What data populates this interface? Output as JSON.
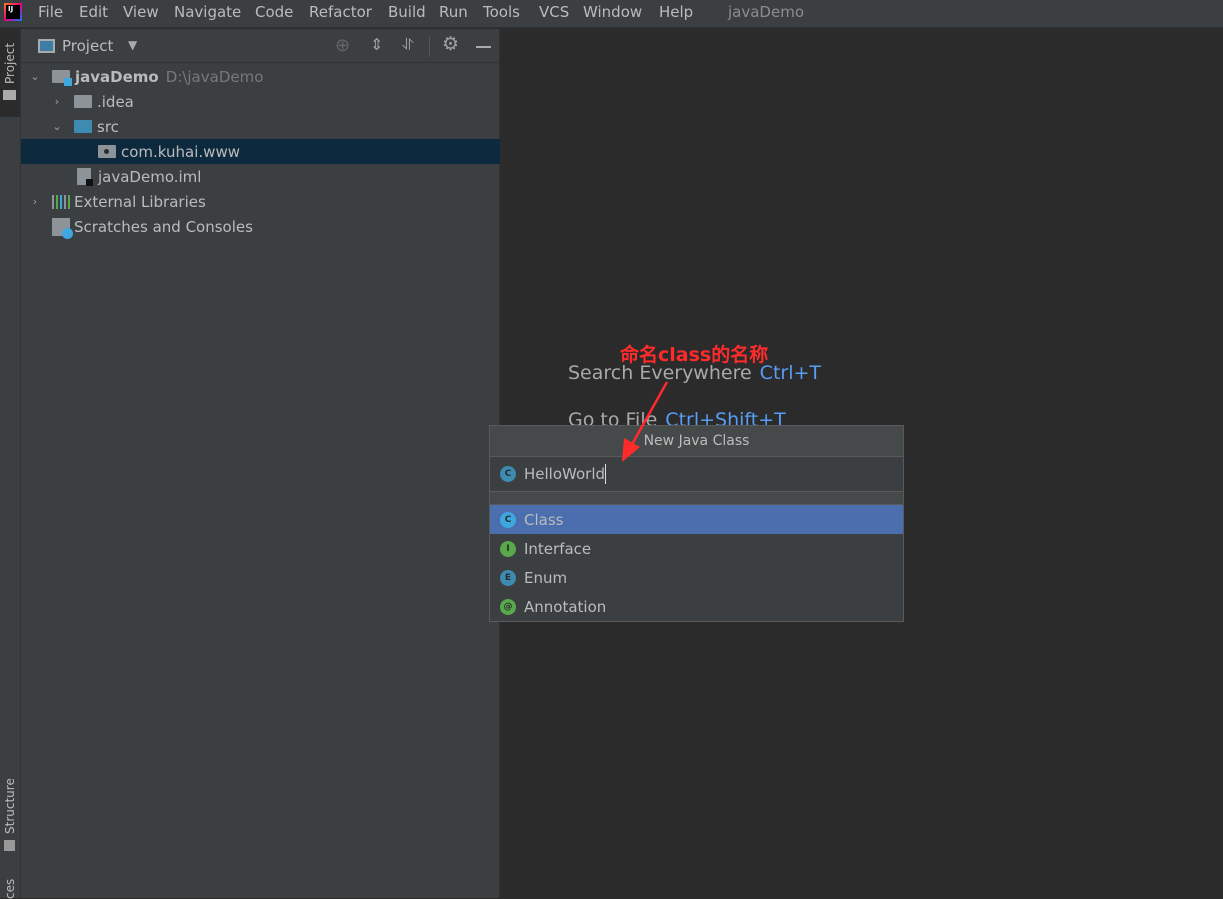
{
  "app": {
    "title": "javaDemo",
    "icon": "intellij-idea-logo",
    "logo_text": "IJ"
  },
  "menu": [
    "File",
    "Edit",
    "View",
    "Navigate",
    "Code",
    "Refactor",
    "Build",
    "Run",
    "Tools",
    "VCS",
    "Window",
    "Help"
  ],
  "stripe": {
    "top_tab": "Project",
    "bottom_tab": "Structure",
    "cut_tab": "ces"
  },
  "panel": {
    "title": "Project",
    "toolbar": [
      "locate-icon",
      "expand-all-icon",
      "collapse-all-icon",
      "gear-icon",
      "minimize-icon"
    ]
  },
  "tree": [
    {
      "label": "javaDemo",
      "path": "D:\\javaDemo",
      "expanded": true
    },
    {
      "label": ".idea",
      "expanded": false
    },
    {
      "label": "src",
      "expanded": true
    },
    {
      "label": "com.kuhai.www",
      "selected": true
    },
    {
      "label": "javaDemo.iml"
    },
    {
      "label": "External Libraries",
      "expanded": false
    },
    {
      "label": "Scratches and Consoles"
    }
  ],
  "editor": {
    "hints": [
      {
        "label": "Search Everywhere",
        "shortcut": "Ctrl+T"
      },
      {
        "label": "Go to File",
        "shortcut": "Ctrl+Shift+T"
      }
    ]
  },
  "dialog": {
    "title": "New Java Class",
    "input_value": "HelloWorld",
    "options": [
      {
        "label": "Class",
        "badge": "C",
        "color": "#3d97c6",
        "selected": true
      },
      {
        "label": "Interface",
        "badge": "I",
        "color": "#59a84b"
      },
      {
        "label": "Enum",
        "badge": "E",
        "color": "#3d97c6"
      },
      {
        "label": "Annotation",
        "badge": "@",
        "color": "#59a84b"
      }
    ]
  },
  "annotation": {
    "text": "命名class的名称",
    "color": "#ff2b2b"
  }
}
